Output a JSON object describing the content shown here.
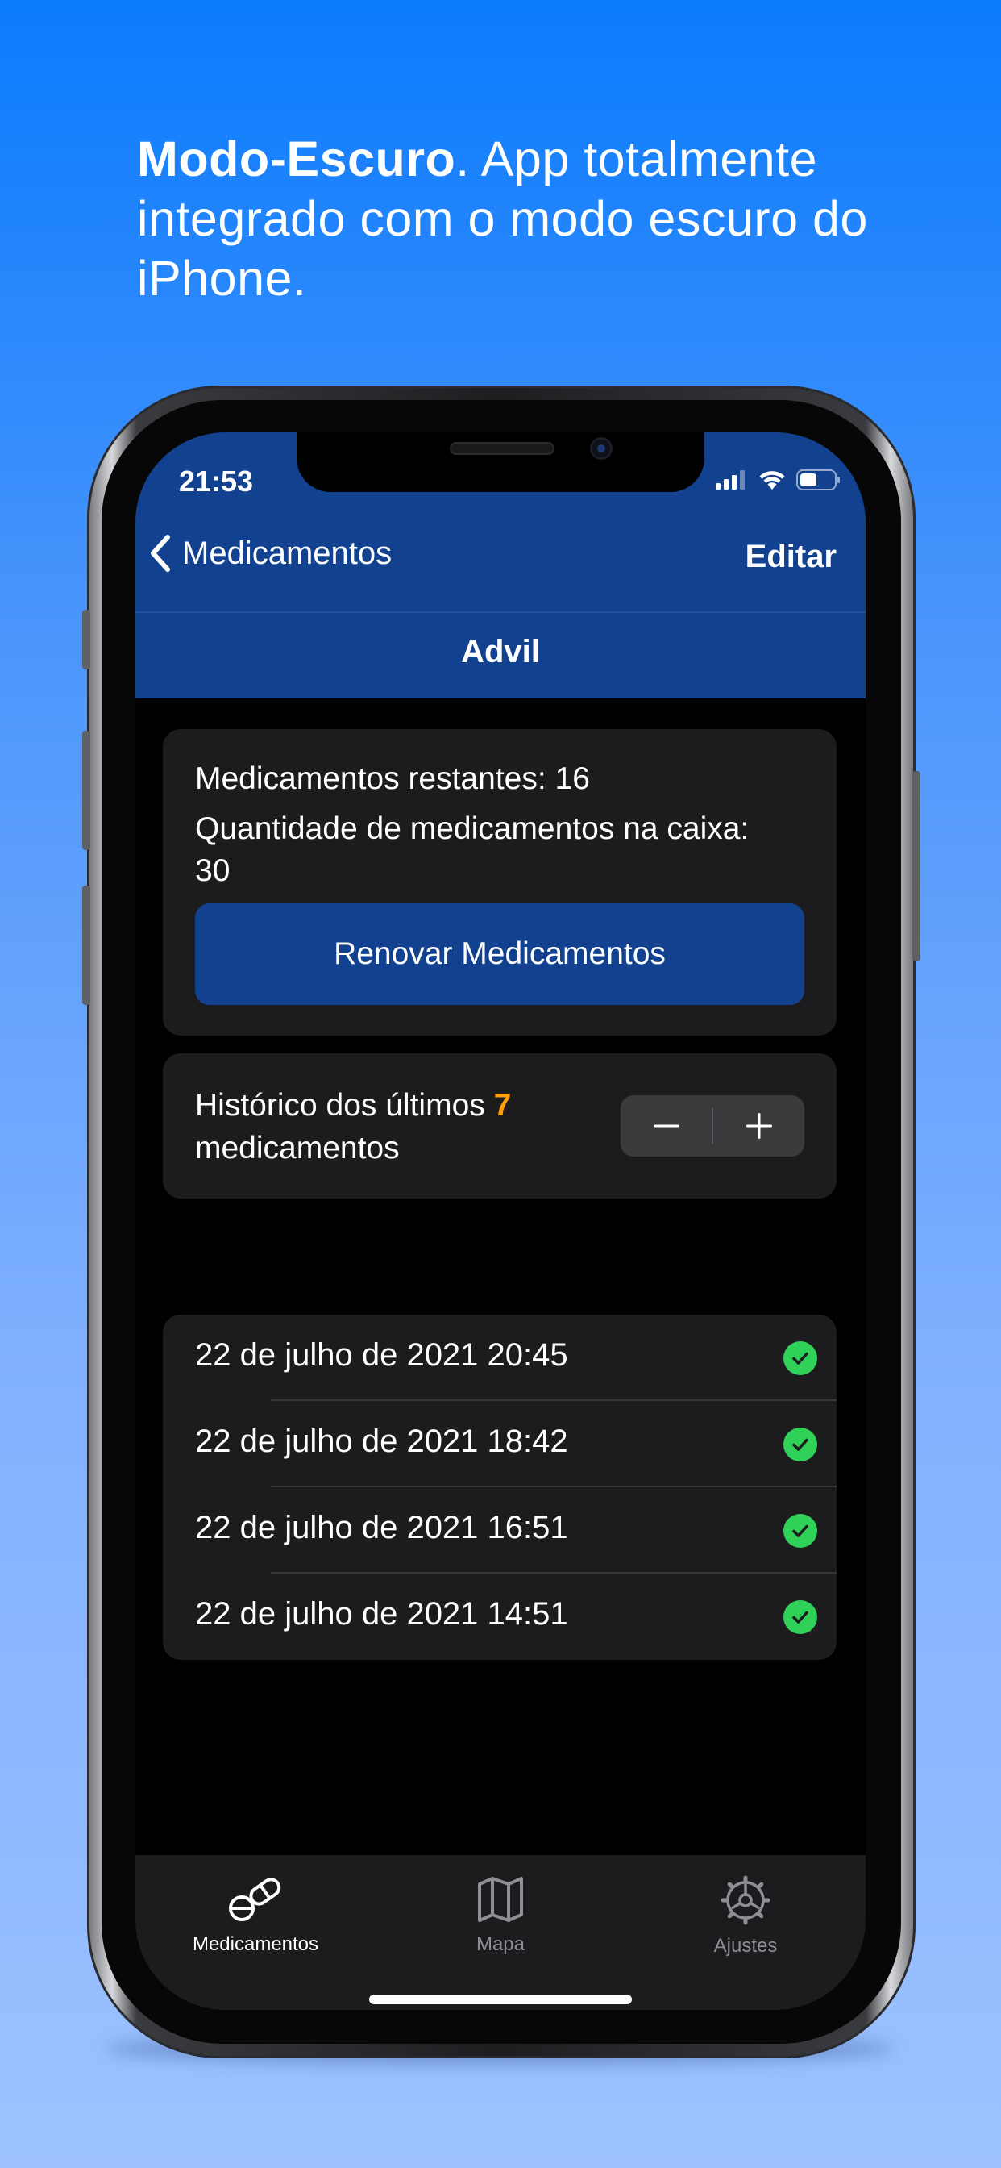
{
  "headline": {
    "bold": "Modo-Escuro",
    "rest": ". App totalmente integrado com o modo escuro do iPhone."
  },
  "status_bar": {
    "time": "21:53"
  },
  "nav": {
    "back_label": "Medicamentos",
    "edit_label": "Editar",
    "title": "Advil"
  },
  "summary_card": {
    "remaining": "Medicamentos restantes: 16",
    "box_quantity_line1": "Quantidade de medicamentos na caixa:",
    "box_quantity_line2": "30",
    "renew_button": "Renovar Medicamentos"
  },
  "history_card": {
    "prefix": "Histórico dos últimos ",
    "count": "7",
    "suffix": "medicamentos",
    "minus": "−",
    "plus": "+"
  },
  "history": [
    {
      "label": "22 de julho de 2021 20:45",
      "taken": true
    },
    {
      "label": "22 de julho de 2021 18:42",
      "taken": true
    },
    {
      "label": "22 de julho de 2021 16:51",
      "taken": true
    },
    {
      "label": "22 de julho de 2021 14:51",
      "taken": true
    }
  ],
  "tabbar": {
    "tabs": [
      {
        "label": "Medicamentos",
        "icon": "pills-icon",
        "active": true
      },
      {
        "label": "Mapa",
        "icon": "map-icon",
        "active": false
      },
      {
        "label": "Ajustes",
        "icon": "gear-icon",
        "active": false
      }
    ]
  },
  "colors": {
    "accent_blue": "#11418f",
    "count_orange": "#ff9f0a",
    "check_green": "#30d158"
  }
}
